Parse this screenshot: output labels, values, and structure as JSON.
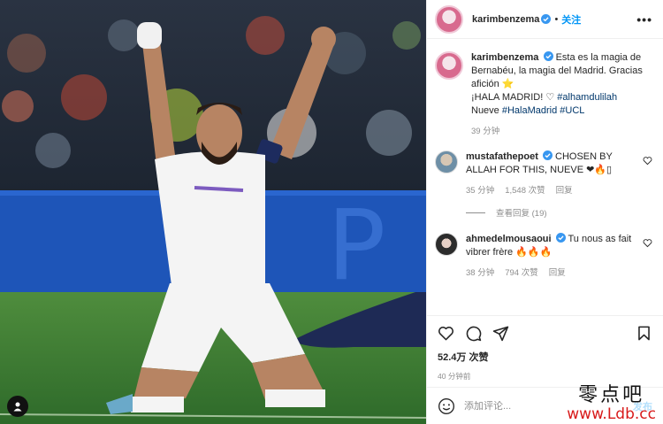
{
  "photo": {
    "alt": ""
  },
  "header": {
    "username": "karimbenzema",
    "separator": "•",
    "follow_label": "关注",
    "more": "•••"
  },
  "caption": {
    "username": "karimbenzema",
    "line1": "Esta es la magia de Bernabéu, la magia del Madrid. Gracias afición ⭐",
    "line2_text": "¡HALA MADRID! ♡ ",
    "line2_tag": "#alhamdulilah",
    "line3_text": "Nueve ",
    "line3_tag1": "#HalaMadrid",
    "line3_tag2": "#UCL",
    "time": "39 分钟"
  },
  "comments": [
    {
      "username": "mustafathepoet",
      "text": "CHOSEN BY ALLAH FOR THIS, NUEVE ❤🔥▯",
      "time": "35 分钟",
      "likes": "1,548 次赞",
      "reply": "回复"
    },
    {
      "username": "ahmedelmousaoui",
      "text": "Tu nous as fait vibrer frère 🔥🔥🔥",
      "time": "38 分钟",
      "likes": "794 次赞",
      "reply": "回复"
    }
  ],
  "view_replies": "查看回复 (19)",
  "stats": {
    "likes": "52.4万 次赞",
    "time": "40 分钟前"
  },
  "composer": {
    "placeholder": "添加评论...",
    "post_label": "发布"
  },
  "watermark": {
    "line1": "零点吧",
    "line2": "www.Ldb.cc"
  },
  "colors": {
    "accent": "#0095f6",
    "heart": "#ed4956",
    "tag": "#00376b"
  }
}
